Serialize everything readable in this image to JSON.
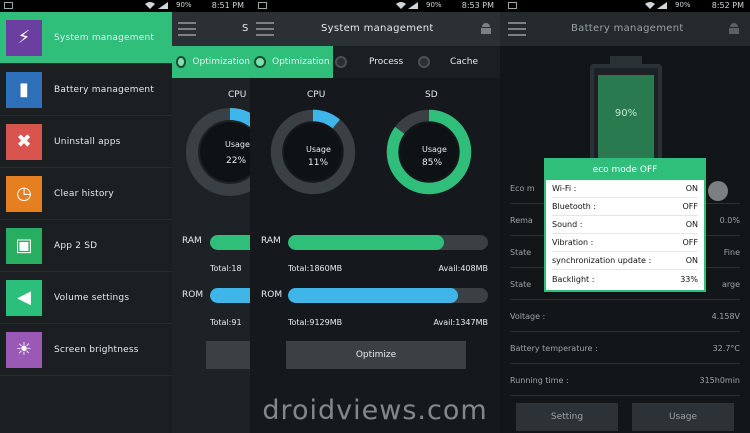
{
  "panel1": {
    "status_time": "8:51 PM",
    "status_battery": "90%",
    "drawer": [
      {
        "label": "System management",
        "icon": "lightning-icon",
        "color": "#6a3fa0",
        "active": true
      },
      {
        "label": "Battery management",
        "icon": "battery-icon",
        "color": "#2d6fb8"
      },
      {
        "label": "Uninstall apps",
        "icon": "trash-icon",
        "color": "#d9534f"
      },
      {
        "label": "Clear history",
        "icon": "clock-icon",
        "color": "#e67e22"
      },
      {
        "label": "App 2 SD",
        "icon": "truck-icon",
        "color": "#27ae60"
      },
      {
        "label": "Volume settings",
        "icon": "speaker-icon",
        "color": "#2bbf7b"
      },
      {
        "label": "Screen brightness",
        "icon": "brightness-icon",
        "color": "#9b59b6"
      }
    ],
    "behind": {
      "title_fragment": "S",
      "tab_fragment": "Optimization",
      "cpu_label": "CPU",
      "cpu_usage_label": "Usage",
      "cpu_usage_value": "22%",
      "cpu_usage_pct": 22,
      "ram_label": "RAM",
      "ram_total": "Total:18",
      "rom_label": "ROM",
      "rom_total": "Total:91"
    }
  },
  "panel2": {
    "status_time": "8:53 PM",
    "status_battery": "90%",
    "title": "System management",
    "tabs": [
      "Optimization",
      "Process",
      "Cache"
    ],
    "cpu": {
      "label": "CPU",
      "usage_label": "Usage",
      "value": "11%",
      "pct": 11
    },
    "sd": {
      "label": "SD",
      "usage_label": "Usage",
      "value": "85%",
      "pct": 85
    },
    "ram": {
      "label": "RAM",
      "total": "Total:1860MB",
      "avail": "Avail:408MB",
      "fill_pct": 78
    },
    "rom": {
      "label": "ROM",
      "total": "Total:9129MB",
      "avail": "Avail:1347MB",
      "fill_pct": 85
    },
    "optimize_label": "Optimize"
  },
  "panel3": {
    "status_time": "8:52 PM",
    "status_battery": "90%",
    "title": "Battery management",
    "battery_pct_label": "90%",
    "battery_pct": 90,
    "rows": [
      {
        "label": "Eco m",
        "value": ""
      },
      {
        "label": "Rema",
        "value": "0.0%"
      },
      {
        "label": "State",
        "value": "Fine"
      },
      {
        "label": "State",
        "value": "arge"
      },
      {
        "label": "Voltage :",
        "value": "4.158V"
      },
      {
        "label": "Battery temperature :",
        "value": "32.7°C"
      },
      {
        "label": "Running time :",
        "value": "315h0min"
      }
    ],
    "setting_label": "Setting",
    "usage_label": "Usage",
    "popup": {
      "title": "eco mode OFF",
      "items": [
        {
          "label": "Wi-Fi :",
          "value": "ON"
        },
        {
          "label": "Bluetooth :",
          "value": "OFF"
        },
        {
          "label": "Sound :",
          "value": "ON"
        },
        {
          "label": "Vibration :",
          "value": "OFF"
        },
        {
          "label": "synchronization update :",
          "value": "ON"
        },
        {
          "label": "Backlight :",
          "value": "33%"
        }
      ]
    }
  },
  "watermark": "droidviews.com",
  "colors": {
    "accent": "#2fbf7b",
    "blue": "#3fb6ea",
    "track": "#3a4044"
  }
}
